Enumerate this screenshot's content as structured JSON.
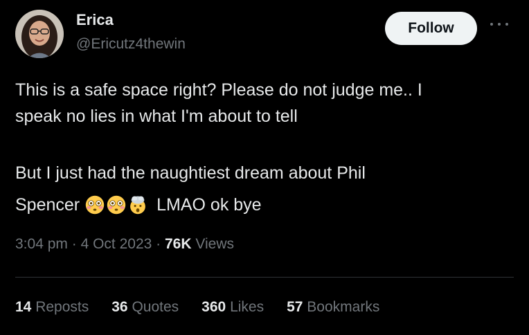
{
  "user": {
    "name": "Erica",
    "handle": "@Ericutz4thewin"
  },
  "actions": {
    "follow_label": "Follow"
  },
  "tweet": {
    "line1": "This is a safe space right? Please do not judge me.. I",
    "line2": "speak no lies in what I'm about to tell",
    "line3": "But I just had the naughtiest dream about Phil",
    "line4_start": "Spencer",
    "line4_end": "LMAO ok bye",
    "emojis": [
      "flushed-face",
      "flushed-face",
      "exploding-head"
    ]
  },
  "meta": {
    "time": "3:04 pm",
    "separator": "·",
    "date": "4 Oct 2023",
    "views_count": "76K",
    "views_label": "Views"
  },
  "stats": {
    "reposts_count": "14",
    "reposts_label": "Reposts",
    "quotes_count": "36",
    "quotes_label": "Quotes",
    "likes_count": "360",
    "likes_label": "Likes",
    "bookmarks_count": "57",
    "bookmarks_label": "Bookmarks"
  },
  "colors": {
    "background": "#000000",
    "text_primary": "#e7e9ea",
    "text_secondary": "#71767b",
    "follow_bg": "#eff3f4",
    "divider": "#2f3336"
  }
}
